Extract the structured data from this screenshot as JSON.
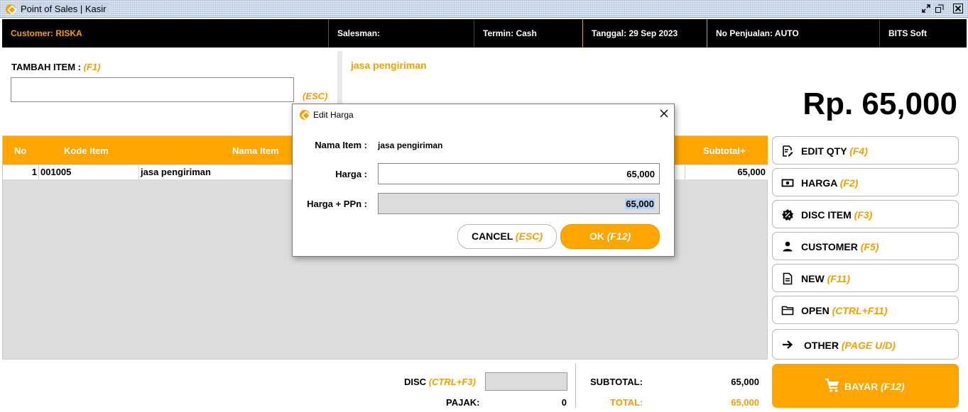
{
  "window": {
    "title": "Point of Sales | Kasir",
    "restore_icon": "restore-icon",
    "close_icon": "close-icon"
  },
  "infobar": {
    "customer_label": "Customer:",
    "customer_value": "RISKA",
    "salesman_label": "Salesman:",
    "salesman_value": "",
    "termin_label": "Termin:",
    "termin_value": "Cash",
    "tanggal_label": "Tanggal:",
    "tanggal_value": "29 Sep 2023",
    "no_penjualan_label": "No Penjualan:",
    "no_penjualan_value": "AUTO",
    "brand": "BITS Soft"
  },
  "add_item": {
    "label": "TAMBAH ITEM :",
    "shortcut": "(F1)",
    "value": "",
    "esc_hint": "(ESC)"
  },
  "display": {
    "item_name": "jasa pengiriman",
    "total": "Rp. 65,000"
  },
  "table": {
    "columns": [
      "No",
      "Kode Item",
      "Nama Item",
      "Subtotal+"
    ],
    "rows": [
      {
        "no": "1",
        "kode": "001005",
        "nama": "jasa pengiriman",
        "subtotal": "65,000"
      }
    ]
  },
  "side_buttons": [
    {
      "label": "EDIT QTY",
      "key": "(F4)",
      "icon": "edit-icon"
    },
    {
      "label": "HARGA",
      "key": "(F2)",
      "icon": "money-icon"
    },
    {
      "label": "DISC ITEM",
      "key": "(F3)",
      "icon": "discount-icon"
    },
    {
      "label": "CUSTOMER",
      "key": "(F5)",
      "icon": "person-icon"
    },
    {
      "label": "NEW",
      "key": "(F11)",
      "icon": "new-doc-icon"
    },
    {
      "label": "OPEN",
      "key": "(CTRL+F11)",
      "icon": "folder-icon"
    },
    {
      "label": "OTHER",
      "key": "(PAGE U/D)",
      "icon": "arrow-right-icon"
    }
  ],
  "pay": {
    "label": "BAYAR",
    "key": "(F12)",
    "icon": "cart-icon"
  },
  "summary": {
    "disc_label": "DISC",
    "disc_key": "(CTRL+F3)",
    "disc_value": "",
    "pajak_label": "PAJAK:",
    "pajak_value": "0",
    "subtotal_label": "SUBTOTAL:",
    "subtotal_value": "65,000",
    "total_label": "TOTAL:",
    "total_value": "65,000"
  },
  "dialog": {
    "title": "Edit Harga",
    "nama_label": "Nama Item :",
    "nama_value": "jasa pengiriman",
    "harga_label": "Harga :",
    "harga_value": "65,000",
    "ppn_label": "Harga + PPn :",
    "ppn_value": "65,000",
    "cancel_label": "CANCEL",
    "cancel_key": "(ESC)",
    "ok_label": "OK",
    "ok_key": "(F12)"
  },
  "colors": {
    "accent": "#ffa500",
    "accent_text": "#f5a000",
    "infobar_bg": "#000000",
    "table_bg": "#dcdcdc"
  }
}
